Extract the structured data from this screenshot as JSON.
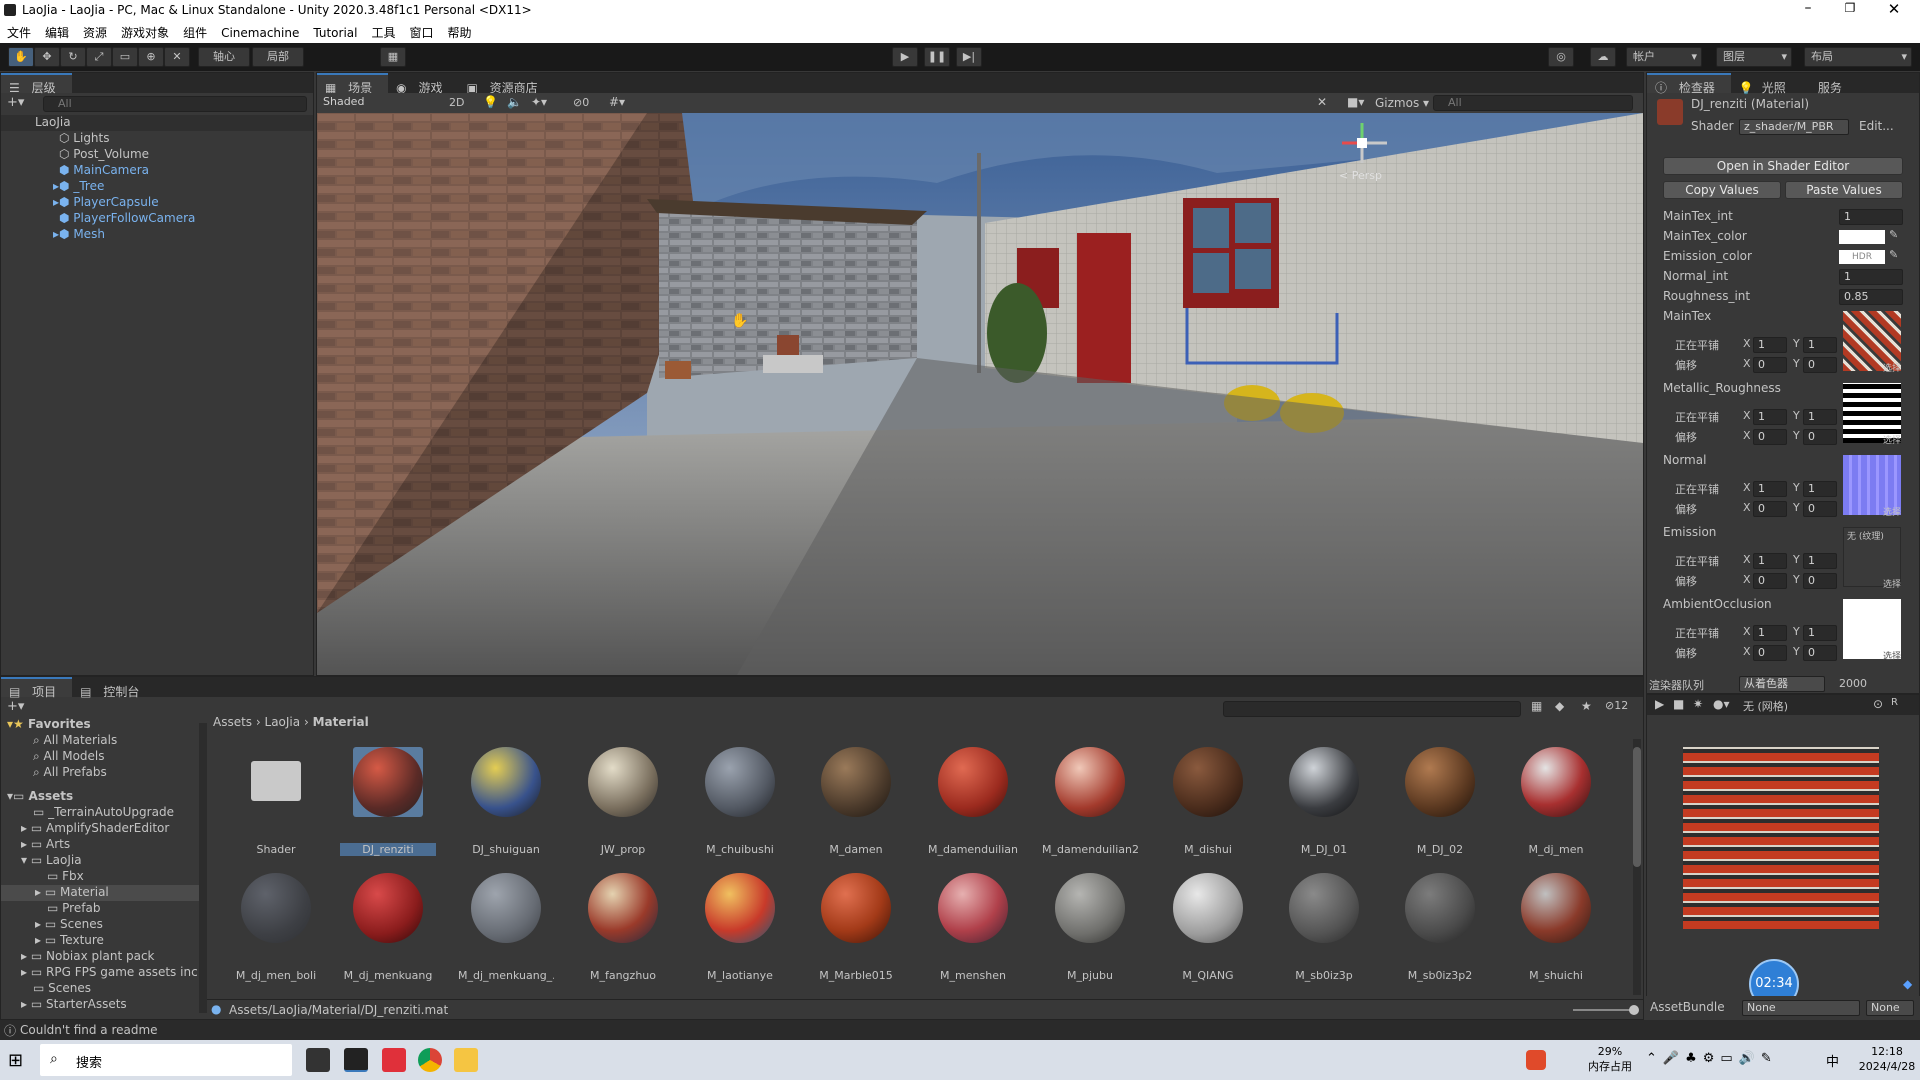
{
  "window": {
    "title": "LaoJia - LaoJia - PC, Mac & Linux Standalone - Unity 2020.3.48f1c1 Personal <DX11>"
  },
  "menu": [
    "文件",
    "编辑",
    "资源",
    "游戏对象",
    "组件",
    "Cinemachine",
    "Tutorial",
    "工具",
    "窗口",
    "帮助"
  ],
  "toolbar": {
    "pivot": "轴心",
    "local": "局部",
    "account": "帐户",
    "layers": "图层",
    "layout": "布局"
  },
  "hierarchy": {
    "tab": "层级",
    "search_placeholder": "All",
    "root": "LaoJia",
    "items": [
      "Lights",
      "Post_Volume",
      "MainCamera",
      "_Tree",
      "PlayerCapsule",
      "PlayerFollowCamera",
      "Mesh"
    ]
  },
  "scene": {
    "tabs": [
      "场景",
      "游戏",
      "资源商店"
    ],
    "shading": "Shaded",
    "mode2d": "2D",
    "hidden_count": "0",
    "gizmos": "Gizmos",
    "search_placeholder": "All",
    "persp": "< Persp"
  },
  "inspector": {
    "tabs": [
      "检查器",
      "光照",
      "服务"
    ],
    "material_name": "DJ_renziti (Material)",
    "shader_label": "Shader",
    "shader_value": "z_shader/M_PBR",
    "edit": "Edit...",
    "open_shader_editor": "Open in Shader Editor",
    "copy_values": "Copy Values",
    "paste_values": "Paste Values",
    "props": [
      {
        "name": "MainTex_int",
        "value": "1"
      },
      {
        "name": "MainTex_color",
        "value": ""
      },
      {
        "name": "Emission_color",
        "value": "HDR"
      },
      {
        "name": "Normal_int",
        "value": "1"
      },
      {
        "name": "Roughness_int",
        "value": "0.85"
      }
    ],
    "textures": [
      {
        "name": "MainTex",
        "tiling_x": "1",
        "tiling_y": "1",
        "offset_x": "0",
        "offset_y": "0",
        "select": "选择"
      },
      {
        "name": "Metallic_Roughness",
        "tiling_x": "1",
        "tiling_y": "1",
        "offset_x": "0",
        "offset_y": "0",
        "select": "选择"
      },
      {
        "name": "Normal",
        "tiling_x": "1",
        "tiling_y": "1",
        "offset_x": "0",
        "offset_y": "0",
        "select": "选择"
      },
      {
        "name": "Emission",
        "tiling_x": "1",
        "tiling_y": "1",
        "offset_x": "0",
        "offset_y": "0",
        "select": "选择",
        "none": "无 (纹理)"
      },
      {
        "name": "AmbientOcclusion",
        "tiling_x": "1",
        "tiling_y": "1",
        "offset_x": "0",
        "offset_y": "0",
        "select": "选择"
      }
    ],
    "tiling_label": "正在平铺",
    "offset_label": "偏移",
    "render_queue_label": "渲染器队列",
    "render_queue_mode": "从着色器",
    "render_queue_value": "2000",
    "preview_mesh": "无 (网格)",
    "assetbundle_label": "AssetBundle",
    "assetbundle_value": "None",
    "assetbundle_variant": "None",
    "timer": "02:34"
  },
  "project": {
    "tabs": [
      "项目",
      "控制台"
    ],
    "hidden_count": "12",
    "favorites_label": "Favorites",
    "favorites": [
      "All Materials",
      "All Models",
      "All Prefabs"
    ],
    "assets_label": "Assets",
    "folders": [
      "_TerrainAutoUpgrade",
      "AmplifyShaderEditor",
      "Arts",
      "LaoJia",
      "Fbx",
      "Material",
      "Prefab",
      "Scenes",
      "Texture",
      "Nobiax plant pack",
      "RPG FPS game assets inc",
      "Scenes",
      "StarterAssets"
    ],
    "breadcrumb": [
      "Assets",
      "LaoJia",
      "Material"
    ],
    "row1": [
      "Shader",
      "DJ_renziti",
      "DJ_shuiguan",
      "JW_prop",
      "M_chuibushi",
      "M_damen",
      "M_damenduilian",
      "M_damenduilian2",
      "M_dishui",
      "M_DJ_01",
      "M_DJ_02",
      "M_dj_men"
    ],
    "row2": [
      "M_dj_men_boli",
      "M_dj_menkuang",
      "M_dj_menkuang_...",
      "M_fangzhuo",
      "M_laotianye",
      "M_Marble015",
      "M_menshen",
      "M_pjubu",
      "M_QIANG",
      "M_sb0iz3p",
      "M_sb0iz3p2",
      "M_shuichi"
    ],
    "path": "Assets/LaoJia/Material/DJ_renziti.mat"
  },
  "status": {
    "message": "Couldn't find a readme"
  },
  "taskbar": {
    "search": "搜索",
    "memory_pct": "29%",
    "memory_label": "内存占用",
    "ime": "中",
    "time": "12:18",
    "date": "2024/4/28"
  }
}
